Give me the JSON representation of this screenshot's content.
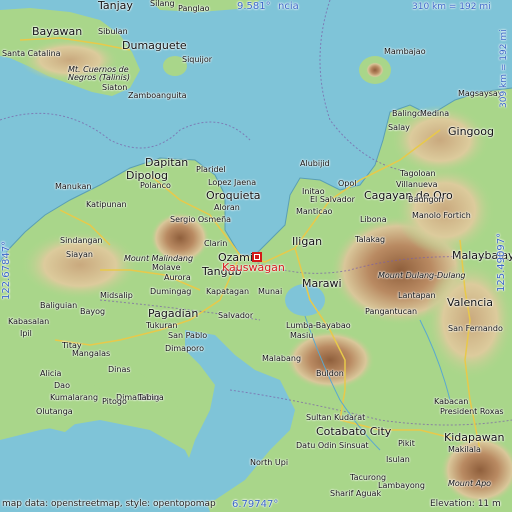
{
  "place": {
    "name": "Kauswagan",
    "highlight_color": "#d41a1a"
  },
  "coordinates": {
    "top_lat": "9.581°",
    "bottom_lat": "6.79747°",
    "left_lon": "122.67847°",
    "right_lon": "125.49097°"
  },
  "scale": {
    "horizontal": "310 km = 192 mi",
    "vertical": "309 km = 192 mi"
  },
  "credit": "map data: openstreetmap, style: opentopomap",
  "overlay_fragments": {
    "top_right_partial": "ncia",
    "bottom_right_partial": "Elevation: 11 m"
  },
  "colors": {
    "sea": "#7fc4d8",
    "lowland": "#a9d68a",
    "hill": "#d9c79a",
    "mountain": "#b98a62",
    "label_blue": "#3a67c7"
  },
  "cities": [
    "Tanjay",
    "Silang",
    "Panglao",
    "Bayawan",
    "Sibulan",
    "Dumaguete",
    "Santa Catalina",
    "Mt. Cuernos de Negros (Talinis)",
    "Siquijor",
    "Siaton",
    "Zamboanguita",
    "Mambajao",
    "Magsaysay",
    "Balingoan",
    "Medina",
    "Salay",
    "Gingoog",
    "Dapitan",
    "Plaridel",
    "Dipolog",
    "Polanco",
    "Lopez Jaena",
    "Manukan",
    "Oroquieta",
    "Katipunan",
    "Aloran",
    "Sergio Osmeña",
    "Alubijid",
    "Initao",
    "Opol",
    "Cagayan de Oro",
    "Tagoloan",
    "Villanueva",
    "Manticao",
    "El Salvador",
    "Baungon",
    "Libona",
    "Manolo Fortich",
    "Talakag",
    "Iligan",
    "Clarin",
    "Ozamiz",
    "Tangub",
    "Sindangan",
    "Siayan",
    "Mount Malindang",
    "Molave",
    "Aurora",
    "Midsalip",
    "Dumingag",
    "Kapatagan",
    "Munai",
    "Marawi",
    "Malaybalay",
    "Mount Dulang-Dulang",
    "Lantapan",
    "Valencia",
    "Bayog",
    "Pagadian",
    "Salvador",
    "Tukuran",
    "Kabasalan",
    "Dimataling",
    "San Pablo",
    "Dinas",
    "Tabina",
    "Pitogo",
    "Dimaporo",
    "Lumba-Bayabao",
    "Masiu",
    "Pangantucan",
    "San Fernando",
    "Malabang",
    "Olutanga",
    "Buldon",
    "Cotabato City",
    "Sultan Kudarat",
    "Kabacan",
    "Datu Odin Sinsuat",
    "President Roxas",
    "Kidapawan",
    "Pikit",
    "Makilala",
    "Mount Apo",
    "North Upi",
    "Sharif Aguak",
    "Lambayong",
    "Isulan",
    "Tacurong",
    "Ipil",
    "Mangalas",
    "Alicia",
    "Titay",
    "Dao",
    "Kumalarang",
    "Baliguian"
  ]
}
